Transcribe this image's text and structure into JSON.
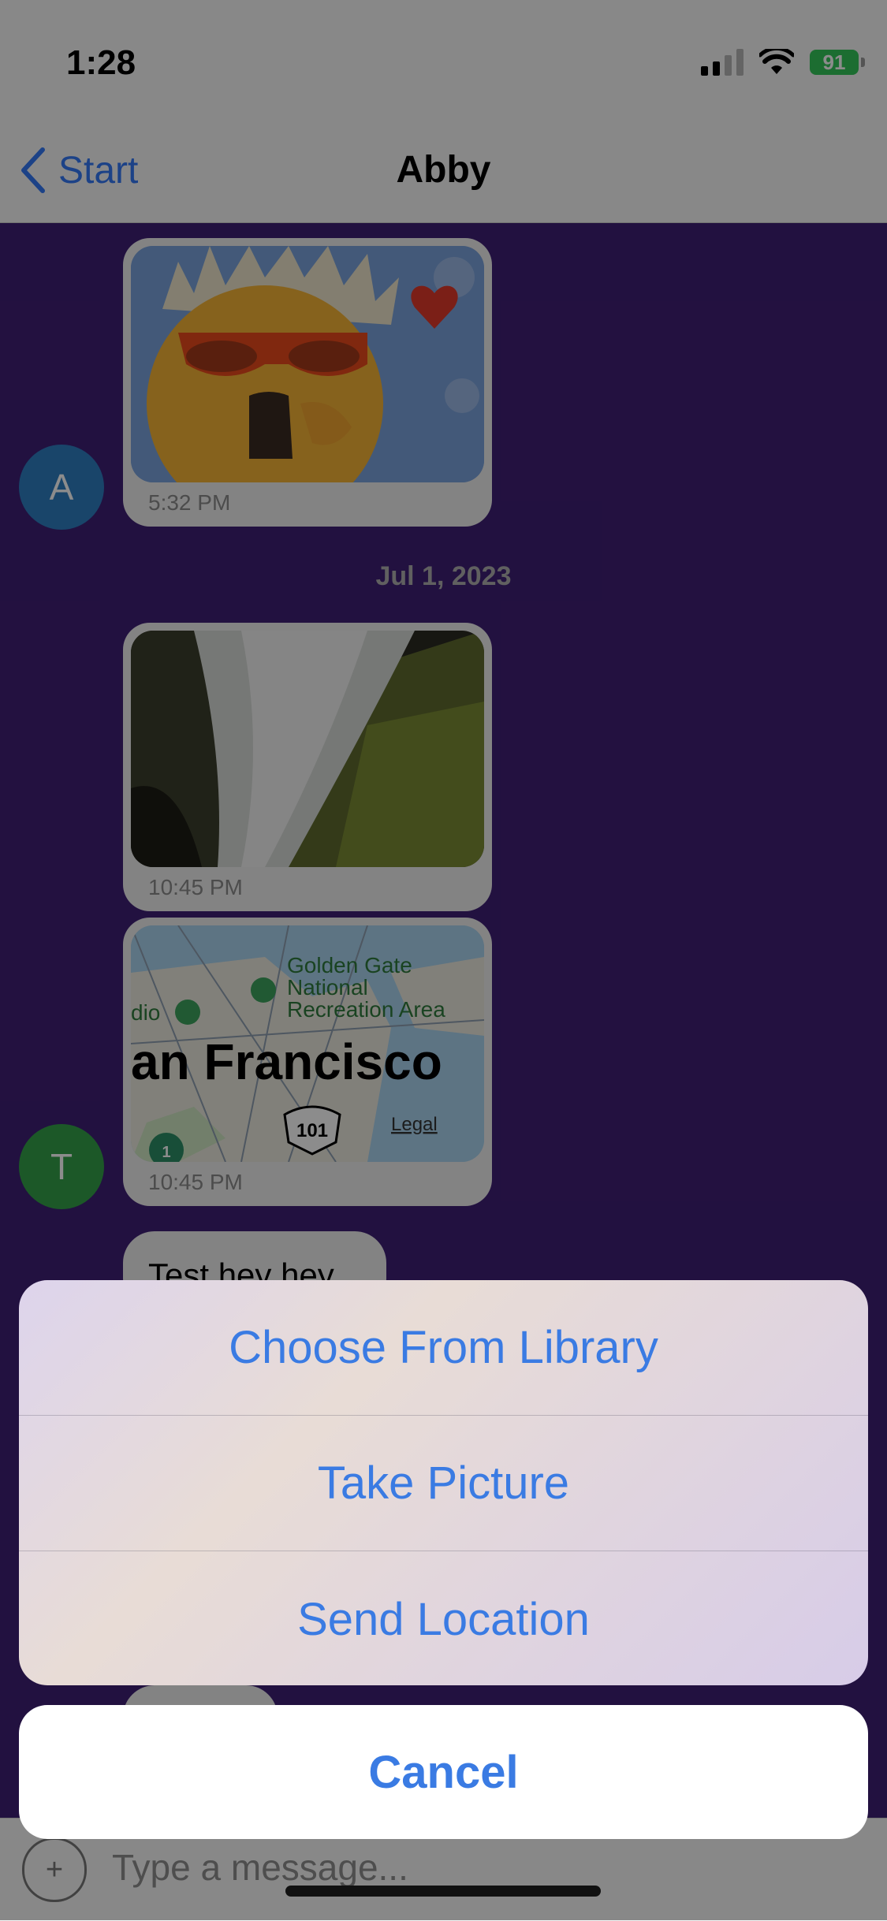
{
  "status_bar": {
    "time": "1:28",
    "battery": "91"
  },
  "nav": {
    "back_label": "Start",
    "title": "Abby"
  },
  "messages": [
    {
      "type": "image",
      "time": "5:32 PM"
    },
    {
      "type": "date_separator",
      "text": "Jul 1, 2023"
    },
    {
      "type": "image",
      "time": "10:45 PM"
    },
    {
      "type": "map",
      "time": "10:45 PM",
      "place_label": "an Francisco",
      "poi_label": "Golden Gate\nNational\nRecreation Area",
      "left_label": "dio",
      "route": "101",
      "route_badge": "1",
      "legal": "Legal"
    },
    {
      "type": "text",
      "text": "Test hey hey"
    }
  ],
  "avatars": [
    {
      "initial": "A",
      "color": "#2e7ec2"
    },
    {
      "initial": "T",
      "color": "#33a04a"
    }
  ],
  "composer": {
    "placeholder": "Type a message..."
  },
  "action_sheet": {
    "options": [
      "Choose From Library",
      "Take Picture",
      "Send Location"
    ],
    "cancel_label": "Cancel"
  },
  "colors": {
    "chat_background": "#3f1f75",
    "accent": "#3a7be3"
  }
}
